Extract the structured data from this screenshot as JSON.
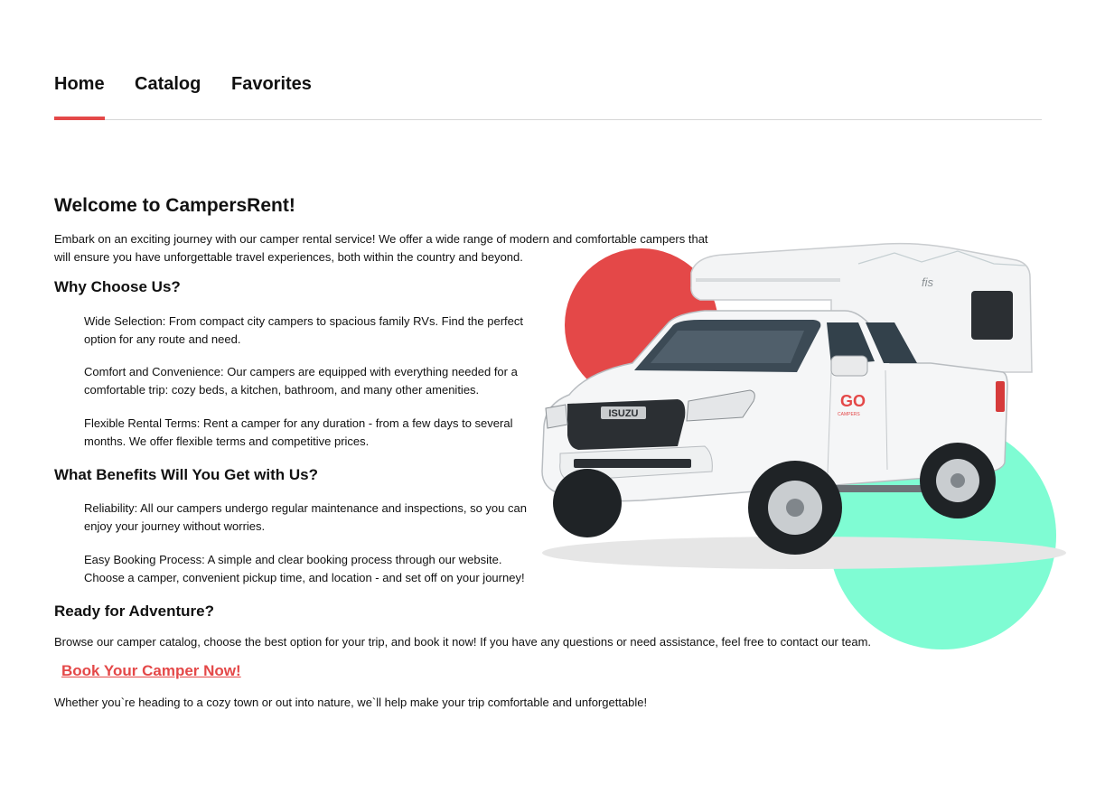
{
  "nav": {
    "items": [
      {
        "label": "Home",
        "active": true
      },
      {
        "label": "Catalog",
        "active": false
      },
      {
        "label": "Favorites",
        "active": false
      }
    ],
    "accent_color": "#e44848"
  },
  "hero": {
    "title": "Welcome to CampersRent!",
    "intro": "Embark on an exciting journey with our camper rental service! We offer a wide range of modern and comfortable campers that will ensure you have unforgettable travel experiences, both within the country and beyond.",
    "image": {
      "icon": "pickup-camper-image",
      "brand_badge": "ISUZU",
      "decal": "GO",
      "decal_sub": "CAMPERS",
      "camper_mark": "fis",
      "circle_colors": [
        "#e44848",
        "#7ffcd3"
      ]
    }
  },
  "why": {
    "heading": "Why Choose Us?",
    "items": [
      "Wide Selection: From compact city campers to spacious family RVs. Find the perfect option for any route and need.",
      "Comfort and Convenience: Our campers are equipped with everything needed for a comfortable trip: cozy beds, a kitchen, bathroom, and many other amenities.",
      "Flexible Rental Terms: Rent a camper for any duration - from a few days to several months. We offer flexible terms and competitive prices."
    ]
  },
  "benefits": {
    "heading": "What Benefits Will You Get with Us?",
    "items": [
      "Reliability: All our campers undergo regular maintenance and inspections, so you can enjoy your journey without worries.",
      "Easy Booking Process: A simple and clear booking process through our website. Choose a camper, convenient pickup time, and location - and set off on your journey!"
    ]
  },
  "ready": {
    "heading": "Ready for Adventure?",
    "text": "Browse our camper catalog, choose the best option for your trip, and book it now! If you have any questions or need assistance, feel free to contact our team.",
    "cta_label": "Book Your Camper Now!",
    "closing": "Whether you`re heading to a cozy town or out into nature, we`ll help make your trip comfortable and unforgettable!"
  }
}
